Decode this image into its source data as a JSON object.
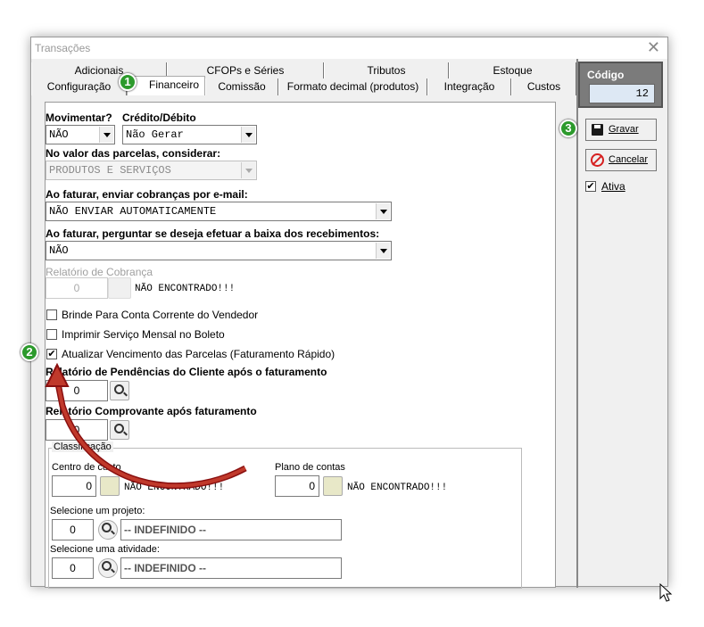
{
  "window": {
    "title": "Transações",
    "close": "✕"
  },
  "tabs_top": [
    "Adicionais",
    "CFOPs e Séries",
    "Tributos",
    "Estoque"
  ],
  "tabs_bottom": [
    "Configuração",
    "Financeiro",
    "Comissão",
    "Formato decimal (produtos)",
    "Integração",
    "Custos"
  ],
  "form": {
    "movimentar_label": "Movimentar?",
    "movimentar_value": "NÃO",
    "credito_label": "Crédito/Débito",
    "credito_value": "Não Gerar",
    "parcelas_label": "No valor das parcelas, considerar:",
    "parcelas_value": "PRODUTOS E SERVIÇOS",
    "email_label": "Ao faturar, enviar cobranças por e-mail:",
    "email_value": "NÃO ENVIAR AUTOMATICAMENTE",
    "baixa_label": "Ao faturar, perguntar se deseja efetuar a baixa dos recebimentos:",
    "baixa_value": "NÃO",
    "rel_cobranca_label": "Relatório de Cobrança",
    "rel_cobranca_value": "0",
    "rel_cobranca_status": "NÃO ENCONTRADO!!!",
    "brinde_label": "Brinde Para Conta Corrente do Vendedor",
    "imprimir_label": "Imprimir Serviço Mensal no Boleto",
    "atualizar_label": "Atualizar Vencimento das Parcelas (Faturamento Rápido)",
    "atualizar_checked": "✔",
    "rel_pend_label": "Relatório de Pendências do Cliente após o faturamento",
    "rel_pend_value": "0",
    "rel_comp_label": "Relatório Comprovante após faturamento",
    "rel_comp_value": "0",
    "classificacao_label": "Classificação",
    "centro_label": "Centro de custo",
    "centro_value": "0",
    "centro_status": "NÃO ENCONTRADO!!!",
    "plano_label": "Plano de contas",
    "plano_value": "0",
    "plano_status": "NÃO ENCONTRADO!!!",
    "projeto_label": "Selecione um projeto:",
    "projeto_value": "0",
    "projeto_text": "-- INDEFINIDO --",
    "atividade_label": "Selecione uma atividade:",
    "atividade_value": "0",
    "atividade_text": "-- INDEFINIDO --"
  },
  "right": {
    "codigo_label": "Código",
    "codigo_value": "12",
    "gravar": "Gravar",
    "cancelar": "Cancelar",
    "ativa": "Ativa",
    "ativa_checked": "✔"
  },
  "badges": [
    "1",
    "2",
    "3"
  ],
  "colors": {
    "badge": "#2c9a2c",
    "arrow": "#c0392b",
    "gravar_icon": "#1a1a1a",
    "cancel_icon": "#d62020"
  }
}
